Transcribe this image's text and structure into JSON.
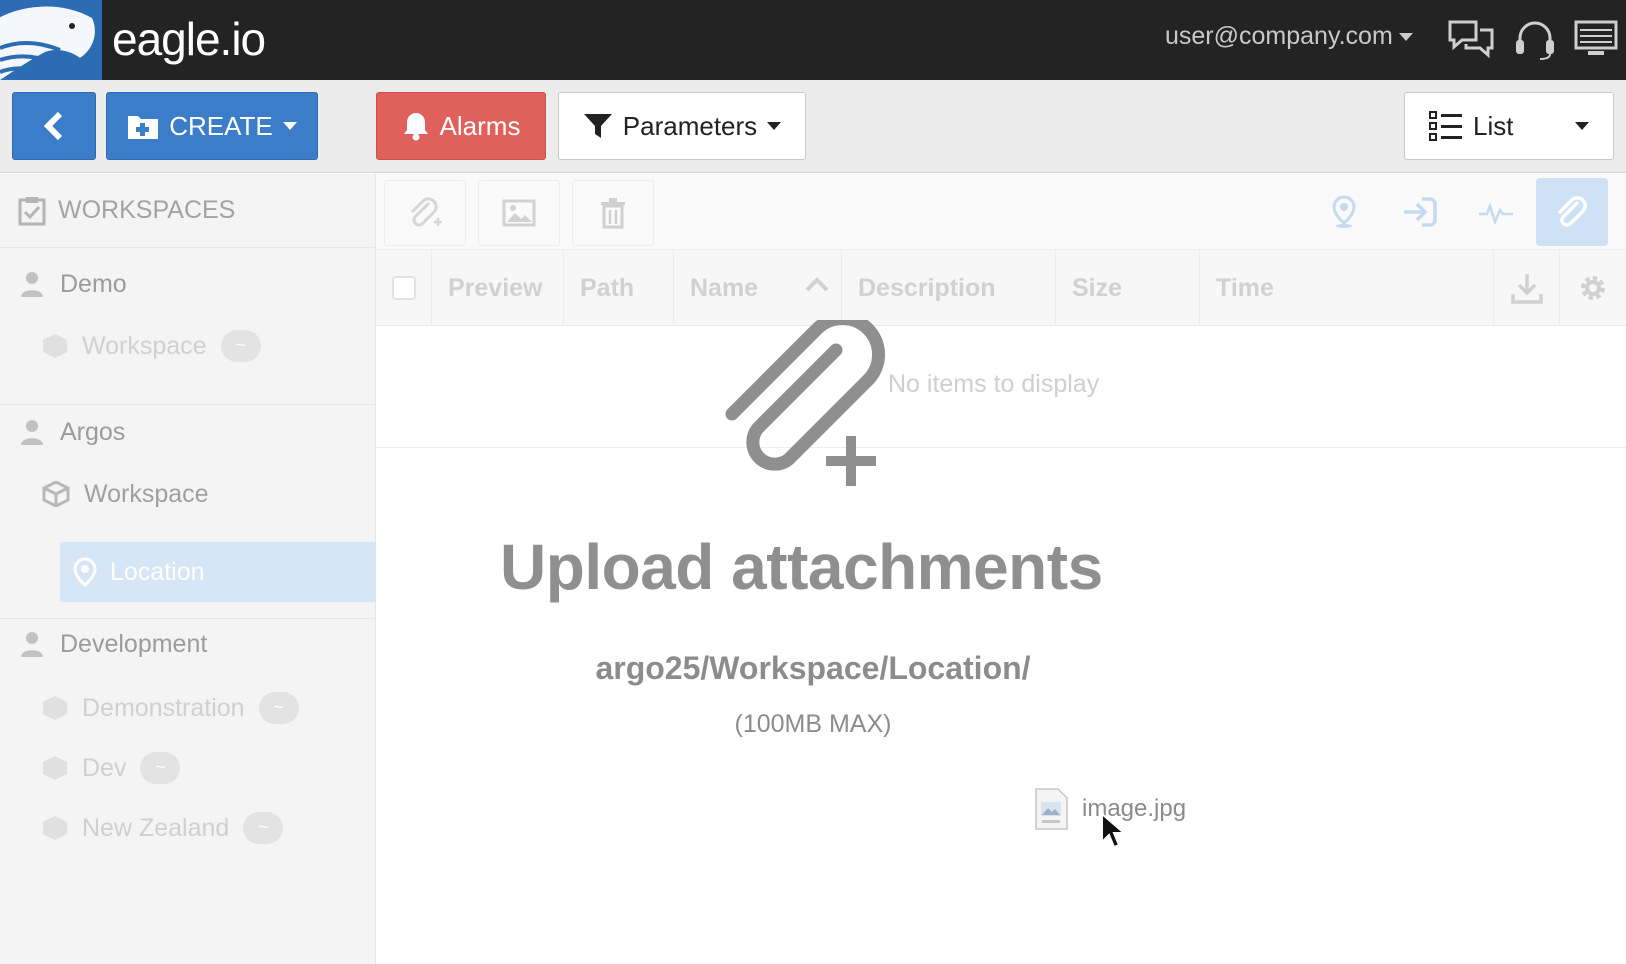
{
  "app": {
    "name": "eagle.io",
    "user": "user@company.com"
  },
  "toolbar": {
    "create_label": "CREATE",
    "alarms_label": "Alarms",
    "parameters_label": "Parameters",
    "view_label": "List"
  },
  "sidebar": {
    "header": "WORKSPACES",
    "groups": [
      {
        "name": "Demo",
        "items": [
          {
            "label": "Workspace",
            "badge": "~"
          }
        ]
      },
      {
        "name": "Argos",
        "items": [
          {
            "label": "Workspace"
          },
          {
            "label": "Location",
            "selected": true
          }
        ]
      },
      {
        "name": "Development",
        "items": [
          {
            "label": "Demonstration",
            "badge": "~"
          },
          {
            "label": "Dev",
            "badge": "~"
          },
          {
            "label": "New Zealand",
            "badge": "~"
          }
        ]
      }
    ]
  },
  "table": {
    "columns": [
      "Preview",
      "Path",
      "Name",
      "Description",
      "Size",
      "Time"
    ],
    "sorted_column": "Name",
    "empty_message": "No items to display"
  },
  "upload": {
    "title": "Upload attachments",
    "path": "argo25/Workspace/Location/",
    "limit": "(100MB MAX)",
    "dragged_file": "image.jpg"
  },
  "colors": {
    "topbar": "#232323",
    "brand_blue": "#2c6cb5",
    "button_blue": "#3b7dc8",
    "alarm_red": "#e0605b"
  }
}
